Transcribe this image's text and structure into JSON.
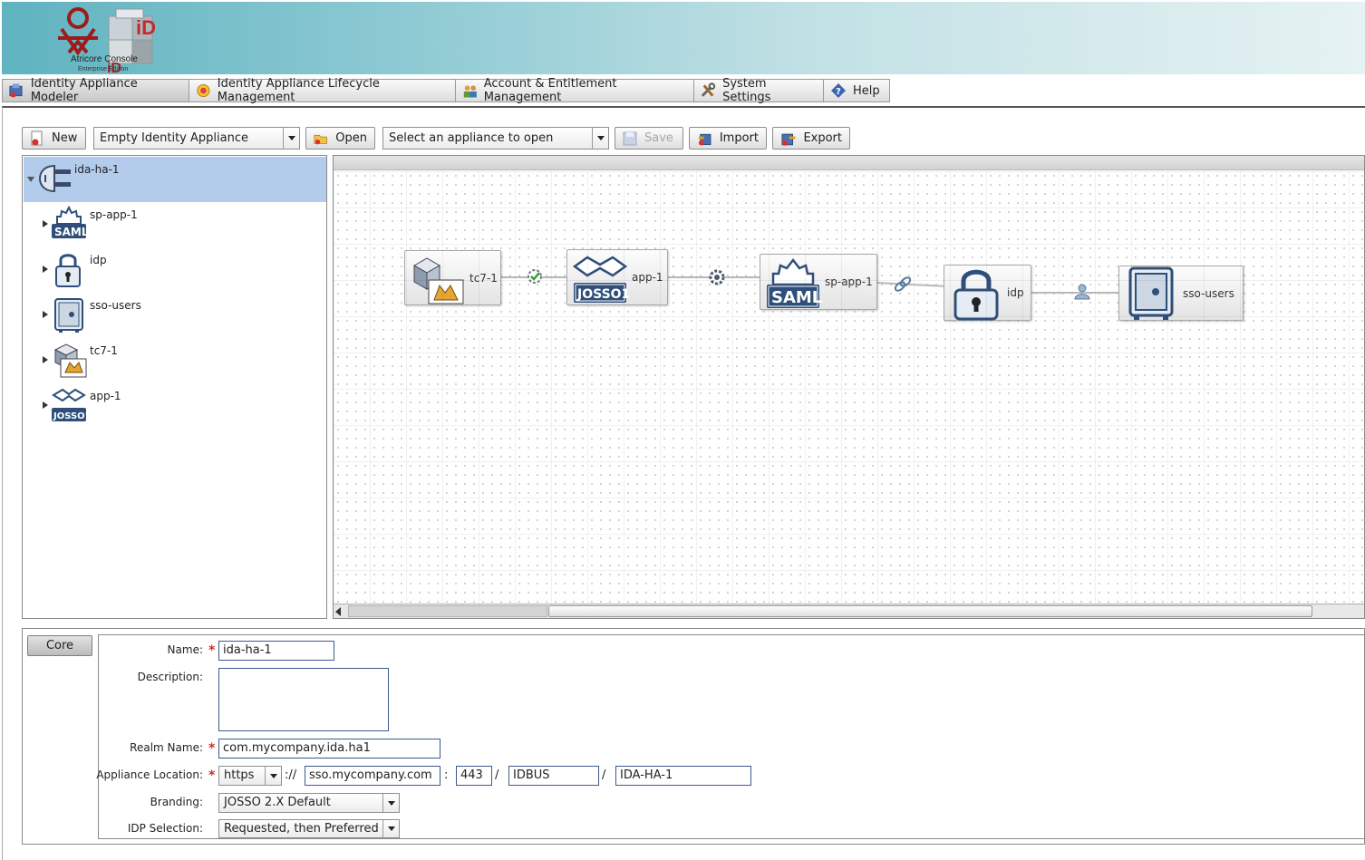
{
  "banner": {
    "logo_title": "Atricore Console",
    "logo_subtitle": "Enterprise Edition"
  },
  "top_tabs": [
    {
      "label": "Identity Appliance Modeler",
      "icon": "modeler-icon",
      "active": true
    },
    {
      "label": "Identity Appliance Lifecycle Management",
      "icon": "lifecycle-icon",
      "active": false
    },
    {
      "label": "Account & Entitlement Management",
      "icon": "users-icon",
      "active": false
    },
    {
      "label": "System Settings",
      "icon": "tools-icon",
      "active": false
    },
    {
      "label": "Help",
      "icon": "help-icon",
      "active": false
    }
  ],
  "toolbar": {
    "new_label": "New",
    "new_combo": "Empty Identity Appliance",
    "open_label": "Open",
    "open_combo": "Select an appliance to open",
    "save_label": "Save",
    "import_label": "Import",
    "export_label": "Export"
  },
  "tree": {
    "root": "ida-ha-1",
    "children": [
      {
        "label": "sp-app-1",
        "icon": "saml-sp-icon"
      },
      {
        "label": "idp",
        "icon": "lock-icon"
      },
      {
        "label": "sso-users",
        "icon": "safe-icon"
      },
      {
        "label": "tc7-1",
        "icon": "tomcat-icon"
      },
      {
        "label": "app-1",
        "icon": "josso-icon"
      }
    ]
  },
  "diagram": {
    "nodes": [
      {
        "label": "tc7-1",
        "icon": "tomcat-icon"
      },
      {
        "label": "app-1",
        "icon": "josso-icon"
      },
      {
        "label": "sp-app-1",
        "icon": "saml-sp-icon"
      },
      {
        "label": "idp",
        "icon": "lock-icon"
      },
      {
        "label": "sso-users",
        "icon": "safe-icon"
      }
    ]
  },
  "properties": {
    "tab": "Core",
    "name_label": "Name:",
    "name_value": "ida-ha-1",
    "description_label": "Description:",
    "description_value": "",
    "realm_label": "Realm Name:",
    "realm_value": "com.mycompany.ida.ha1",
    "location_label": "Appliance Location:",
    "protocol": "https",
    "scheme_sep": "://",
    "host": "sso.mycompany.com",
    "port_sep": ":",
    "port": "443",
    "path_sep1": "/",
    "context": "IDBUS",
    "path_sep2": "/",
    "path": "IDA-HA-1",
    "branding_label": "Branding:",
    "branding_value": "JOSSO 2.X Default",
    "idp_selection_label": "IDP Selection:",
    "idp_selection_value": "Requested, then Preferred"
  }
}
